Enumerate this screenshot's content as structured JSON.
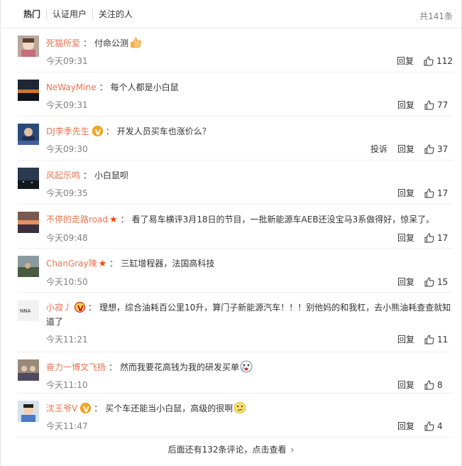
{
  "tabs": [
    {
      "label": "热门"
    },
    {
      "label": "认证用户"
    },
    {
      "label": "关注的人"
    }
  ],
  "total_label": "共141条",
  "colors": {
    "name": "#eb7350",
    "star": "#ff4200",
    "badge_gold": "#f5a623"
  },
  "actions": {
    "reply": "回复",
    "report": "投诉"
  },
  "comments": [
    {
      "name": "死猫所爱",
      "badge": "",
      "star": false,
      "text": "付命公测",
      "emoji": "thumbs-up-emoji",
      "time": "今天09:31",
      "likes": "112",
      "report": false,
      "avatar": "child-photo"
    },
    {
      "name": "NeWayMine",
      "badge": "",
      "star": false,
      "text": "每个人都是小白鼠",
      "emoji": "",
      "time": "今天09:31",
      "likes": "77",
      "report": false,
      "avatar": "sunset-photo"
    },
    {
      "name": "DJ李季先生",
      "badge": "gold",
      "star": false,
      "text": "开发人员买车也涨价么？",
      "emoji": "",
      "time": "今天09:30",
      "likes": "37",
      "report": true,
      "avatar": "dj-photo"
    },
    {
      "name": "风起乐鸣",
      "badge": "",
      "star": false,
      "text": "小白鼠呗",
      "emoji": "",
      "time": "今天09:35",
      "likes": "17",
      "report": false,
      "avatar": "night-photo"
    },
    {
      "name": "不停的走路road",
      "badge": "",
      "star": true,
      "text": "看了易车横评3月18日的节目，一批新能源车AEB还没宝马3系做得好，惊呆了。",
      "emoji": "",
      "time": "今天09:48",
      "likes": "17",
      "report": false,
      "avatar": "dusk-photo"
    },
    {
      "name": "ChanGray陳",
      "badge": "",
      "star": true,
      "text": "三缸增程器，法国高科技",
      "emoji": "",
      "time": "今天10:50",
      "likes": "15",
      "report": false,
      "avatar": "outdoor-photo"
    },
    {
      "name": "小寂丿",
      "badge": "red",
      "star": false,
      "text": "理想，综合油耗百公里10升，算门子新能源汽车！！！别他妈的和我杠，去小熊油耗查查就知道了",
      "emoji": "",
      "time": "今天11:21",
      "likes": "11",
      "report": false,
      "avatar": "logo-photo"
    },
    {
      "name": "奋力一博文飞扬",
      "badge": "",
      "star": false,
      "text": "然而我要花高钱为我的研发买单",
      "emoji": "crying-face-emoji",
      "time": "今天11:10",
      "likes": "8",
      "report": false,
      "avatar": "group-photo"
    },
    {
      "name": "沈王爷V",
      "badge": "gold",
      "star": false,
      "text": "买个车还能当小白鼠，高级的很啊",
      "emoji": "thinking-face-emoji",
      "time": "今天11:47",
      "likes": "4",
      "report": false,
      "avatar": "kid-photo"
    }
  ],
  "more_label": "后面还有132条评论，点击查看"
}
